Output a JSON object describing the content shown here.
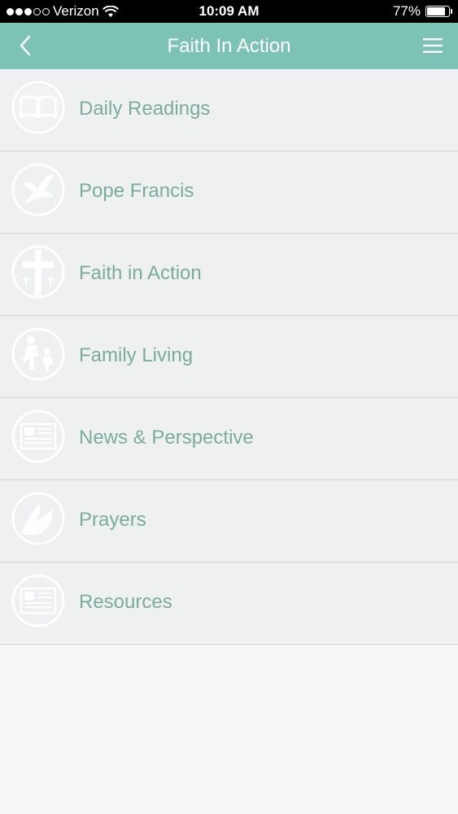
{
  "status": {
    "carrier": "Verizon",
    "time": "10:09 AM",
    "battery": "77%"
  },
  "nav": {
    "title": "Faith In Action"
  },
  "menu": [
    {
      "label": "Daily Readings",
      "icon": "open-book-icon"
    },
    {
      "label": "Pope Francis",
      "icon": "dove-icon"
    },
    {
      "label": "Faith in Action",
      "icon": "cross-icon"
    },
    {
      "label": "Family Living",
      "icon": "family-icon"
    },
    {
      "label": "News & Perspective",
      "icon": "newspaper-icon"
    },
    {
      "label": "Prayers",
      "icon": "praying-hands-icon"
    },
    {
      "label": "Resources",
      "icon": "resources-icon"
    }
  ],
  "colors": {
    "nav_bg": "#7cc2b5",
    "label": "#7aac9f",
    "row_bg": "#eef0f1"
  }
}
